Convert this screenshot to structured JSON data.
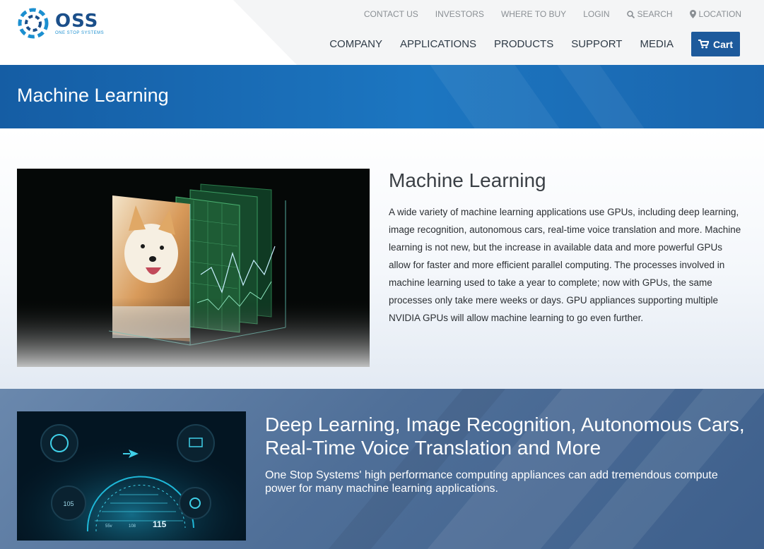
{
  "header": {
    "logo_text": "OSS",
    "logo_subtext": "ONE STOP SYSTEMS",
    "utility_nav": [
      {
        "label": "CONTACT US"
      },
      {
        "label": "INVESTORS"
      },
      {
        "label": "WHERE TO BUY"
      },
      {
        "label": "LOGIN"
      },
      {
        "label": "SEARCH",
        "icon": "search-icon"
      },
      {
        "label": "LOCATION",
        "icon": "location-pin-icon"
      }
    ],
    "main_nav": [
      {
        "label": "COMPANY"
      },
      {
        "label": "APPLICATIONS"
      },
      {
        "label": "PRODUCTS"
      },
      {
        "label": "SUPPORT"
      },
      {
        "label": "MEDIA"
      }
    ],
    "cart_label": "Cart"
  },
  "banner": {
    "title": "Machine Learning"
  },
  "section1": {
    "title": "Machine Learning",
    "body": "A wide variety of machine learning applications use GPUs, including deep learning, image recognition, autonomous cars, real-time voice translation and more. Machine learning is not new, but the increase in available data and more powerful GPUs allow for faster and more efficient parallel computing. The processes involved in machine learning used to take a year to complete; now with GPUs, the same processes only take mere weeks or days. GPU appliances supporting multiple NVIDIA GPUs will allow machine learning to go even further."
  },
  "section2": {
    "title": "Deep Learning, Image Recognition, Autonomous Cars, Real-Time Voice Translation and More",
    "body": "One Stop Systems' high performance computing appliances can add tremendous compute power for many machine learning applications.",
    "dashboard": {
      "gauge_value": "105",
      "speed": "115",
      "voltage": "55v",
      "temp": "108"
    }
  },
  "colors": {
    "brand_blue": "#1d5a9c",
    "banner_blue": "#1a6cb6",
    "accent_cyan": "#1b8fd0"
  }
}
